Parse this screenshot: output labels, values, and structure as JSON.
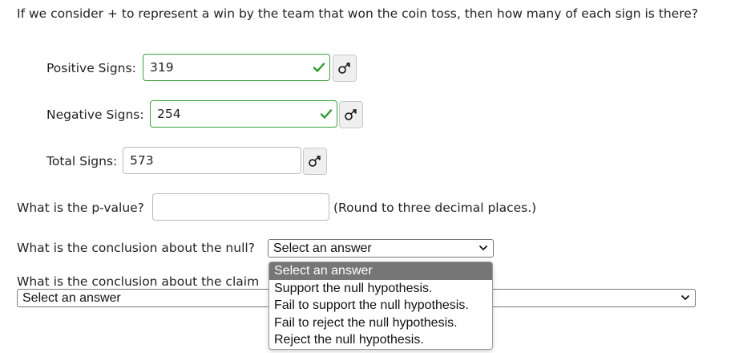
{
  "question": "If we consider + to represent a win by the team that won the coin toss, then how many of each sign is there?",
  "positive": {
    "label": "Positive Signs:",
    "value": "319",
    "correct": true
  },
  "negative": {
    "label": "Negative Signs:",
    "value": "254",
    "correct": true
  },
  "total": {
    "label": "Total Signs:",
    "value": "573"
  },
  "pvalue": {
    "label": "What is the p-value?",
    "value": "",
    "note": "(Round to three decimal places.)"
  },
  "null_conclusion": {
    "label": "What is the conclusion about the null?",
    "selected": "Select an answer"
  },
  "claim_conclusion": {
    "label": "What is the conclusion about the claim",
    "selected": "Select an answer"
  },
  "dropdown_options": [
    "Select an answer",
    "Support the null hypothesis.",
    "Fail to support the null hypothesis.",
    "Fail to reject the null hypothesis.",
    "Reject the null hypothesis."
  ],
  "colors": {
    "correct_border": "#3aa23a",
    "selected_option_bg": "#767676"
  }
}
